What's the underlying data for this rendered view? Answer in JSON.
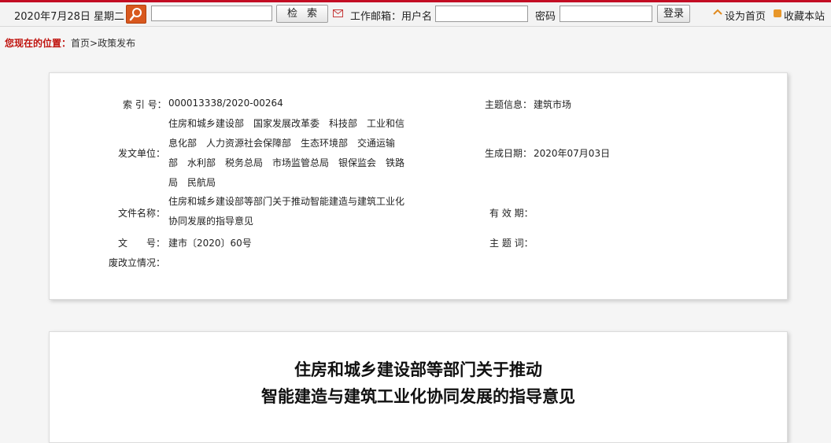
{
  "topbar": {
    "date": "2020年7月28日 星期二",
    "search_placeholder": "",
    "search_button": "检索",
    "mail_label": "工作邮箱：用户名",
    "password_label": "密码",
    "login_button": "登录",
    "set_home": "设为首页",
    "favorite": "收藏本站"
  },
  "breadcrumb": {
    "here": "您现在的位置：",
    "path": "首页>政策发布"
  },
  "info": {
    "index_label": "索 引 号：",
    "index_value": "000013338/2020-00264",
    "topic_label": "主题信息：",
    "topic_value": "建筑市场",
    "issuer_label": "发文单位：",
    "issuer_lines": [
      "住房和城乡建设部　国家发展改革委　科技部　工业和信",
      "息化部　人力资源社会保障部　生态环境部　交通运输",
      "部　水利部　税务总局　市场监管总局　银保监会　铁路",
      "局　民航局"
    ],
    "date_label": "生成日期：",
    "date_value": "2020年07月03日",
    "name_label": "文件名称：",
    "name_lines": [
      "住房和城乡建设部等部门关于推动智能建造与建筑工业化",
      "协同发展的指导意见"
    ],
    "validity_label": "有 效 期：",
    "docno_label": "文　　号：",
    "docno_value": "建市〔2020〕60号",
    "keywords_label": "主 题 词：",
    "abolish_label": "废改立情况："
  },
  "document": {
    "title_line1": "住房和城乡建设部等部门关于推动",
    "title_line2": "智能建造与建筑工业化协同发展的指导意见"
  },
  "colors": {
    "accent_red": "#c30d23",
    "search_orange": "#d8581e"
  }
}
